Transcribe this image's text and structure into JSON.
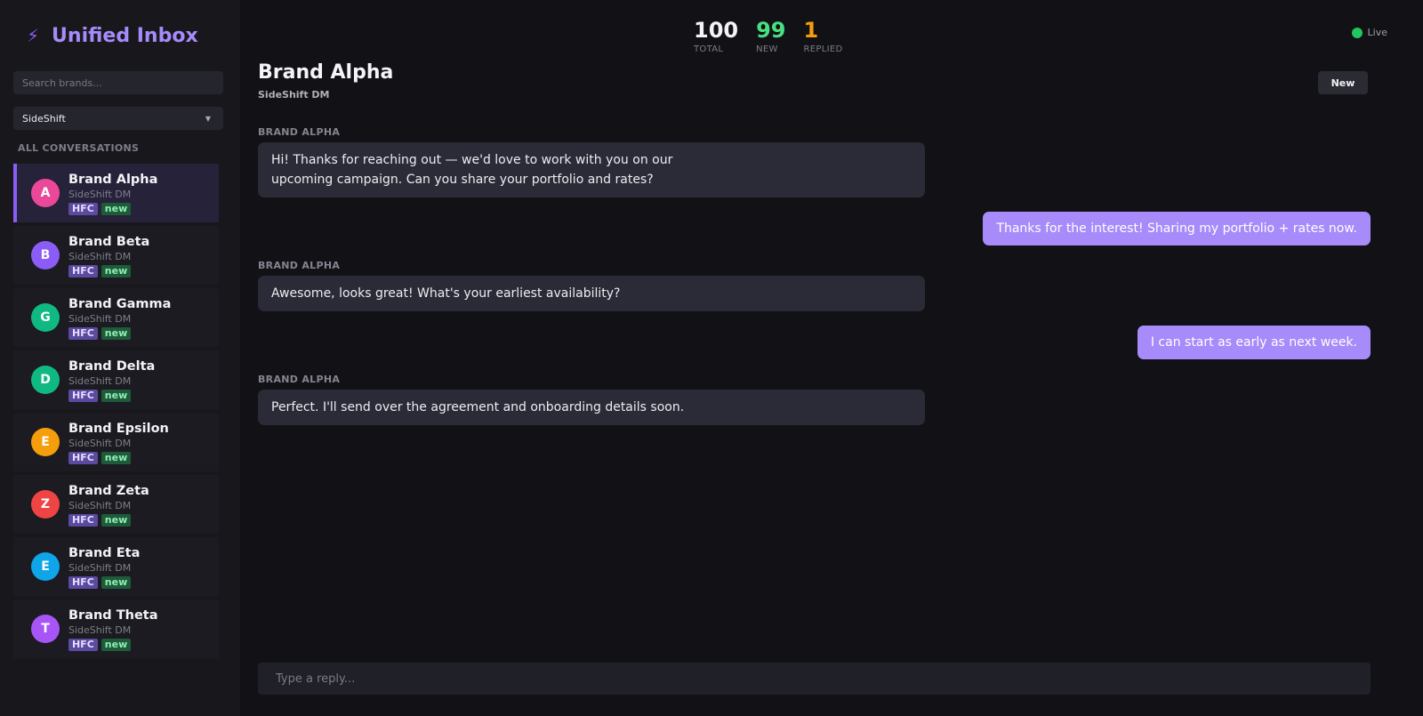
{
  "app": {
    "title": "Unified Inbox",
    "icon": "bolt-icon"
  },
  "sidebar": {
    "search_placeholder": "Search brands...",
    "filter_selected": "SideShift",
    "section_label": "ALL CONVERSATIONS",
    "conversations": [
      {
        "initial": "A",
        "name": "Brand Alpha",
        "source": "SideShift DM",
        "tag": "HFC",
        "status": "new",
        "color": "#ec4899",
        "active": true
      },
      {
        "initial": "B",
        "name": "Brand Beta",
        "source": "SideShift DM",
        "tag": "HFC",
        "status": "new",
        "color": "#8b5cf6"
      },
      {
        "initial": "G",
        "name": "Brand Gamma",
        "source": "SideShift DM",
        "tag": "HFC",
        "status": "new",
        "color": "#10b981"
      },
      {
        "initial": "D",
        "name": "Brand Delta",
        "source": "SideShift DM",
        "tag": "HFC",
        "status": "new",
        "color": "#10b981"
      },
      {
        "initial": "E",
        "name": "Brand Epsilon",
        "source": "SideShift DM",
        "tag": "HFC",
        "status": "new",
        "color": "#f59e0b"
      },
      {
        "initial": "Z",
        "name": "Brand Zeta",
        "source": "SideShift DM",
        "tag": "HFC",
        "status": "new",
        "color": "#ef4444"
      },
      {
        "initial": "E",
        "name": "Brand Eta",
        "source": "SideShift DM",
        "tag": "HFC",
        "status": "new",
        "color": "#0ea5e9"
      },
      {
        "initial": "T",
        "name": "Brand Theta",
        "source": "SideShift DM",
        "tag": "HFC",
        "status": "new",
        "color": "#a855f7"
      }
    ]
  },
  "stats": [
    {
      "value": "100",
      "label": "TOTAL",
      "color": "#f3f3f6"
    },
    {
      "value": "99",
      "label": "NEW",
      "color": "#4ade80"
    },
    {
      "value": "1",
      "label": "REPLIED",
      "color": "#f59e0b"
    }
  ],
  "live_label": "Live",
  "conversation": {
    "title": "Brand Alpha",
    "subtitle": "SideShift DM",
    "status_button": "New",
    "messages": [
      {
        "dir": "in",
        "sender": "BRAND ALPHA",
        "lines": [
          "Hi! Thanks for reaching out — we'd love to work with you on our",
          "upcoming campaign. Can you share your portfolio and rates?"
        ]
      },
      {
        "dir": "out",
        "text": "Thanks for the interest! Sharing my portfolio + rates now."
      },
      {
        "dir": "in",
        "sender": "BRAND ALPHA",
        "lines": [
          "Awesome, looks great! What's your earliest availability?"
        ]
      },
      {
        "dir": "out",
        "text": "I can start as early as next week."
      },
      {
        "dir": "in",
        "sender": "BRAND ALPHA",
        "lines": [
          "Perfect. I'll send over the agreement and onboarding details soon."
        ]
      }
    ],
    "reply_placeholder": "Type a reply..."
  }
}
